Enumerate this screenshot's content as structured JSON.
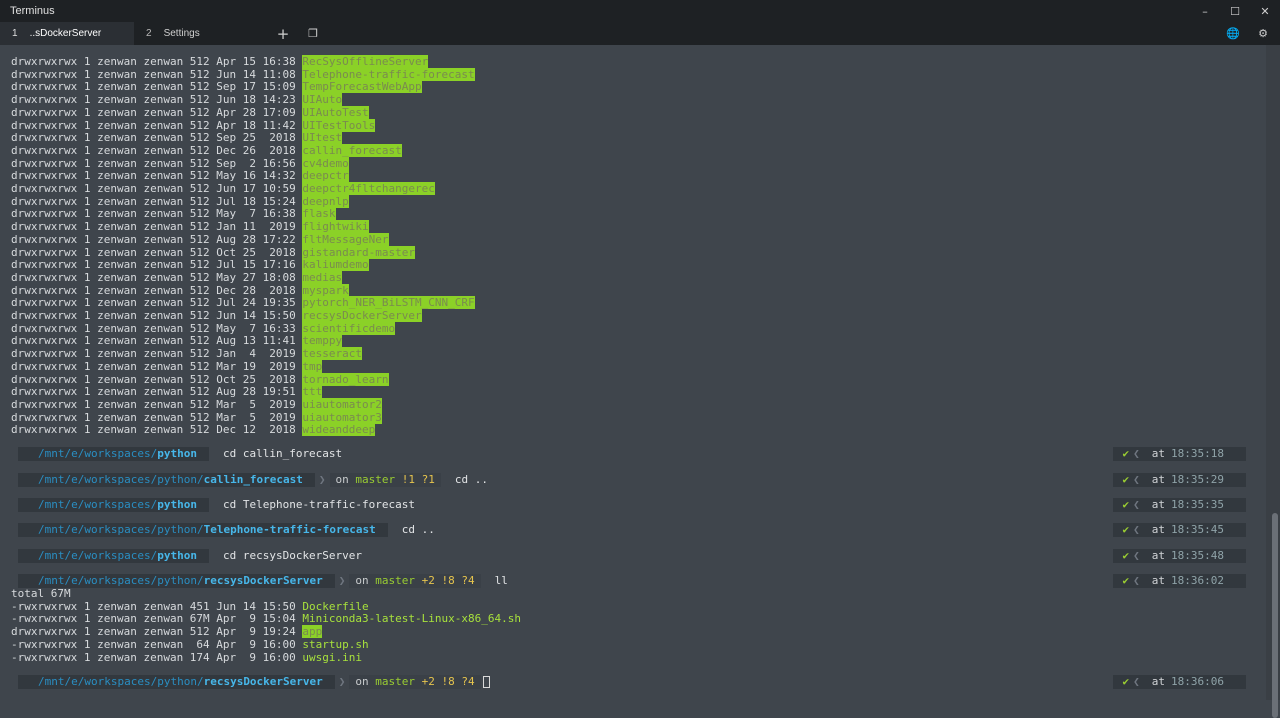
{
  "app": {
    "title": "Terminus",
    "window_controls": [
      "–",
      "☐",
      "✕"
    ]
  },
  "tabs": [
    {
      "num": "1",
      "label": "..sDockerServer",
      "active": true
    },
    {
      "num": "2",
      "label": "Settings",
      "active": false
    }
  ],
  "tabbar_buttons": {
    "add": "+",
    "restore": "❐",
    "globe": "🌐",
    "gear": "⚙"
  },
  "listing": [
    {
      "perm": "drwxrwxrwx",
      "links": "1",
      "user": "zenwan",
      "group": "zenwan",
      "size": "512",
      "date": "Apr 15 16:38",
      "name": "RecSysOfflineServer"
    },
    {
      "perm": "drwxrwxrwx",
      "links": "1",
      "user": "zenwan",
      "group": "zenwan",
      "size": "512",
      "date": "Jun 14 11:08",
      "name": "Telephone-traffic-forecast"
    },
    {
      "perm": "drwxrwxrwx",
      "links": "1",
      "user": "zenwan",
      "group": "zenwan",
      "size": "512",
      "date": "Sep 17 15:09",
      "name": "TempForecastWebApp"
    },
    {
      "perm": "drwxrwxrwx",
      "links": "1",
      "user": "zenwan",
      "group": "zenwan",
      "size": "512",
      "date": "Jun 18 14:23",
      "name": "UIAuto"
    },
    {
      "perm": "drwxrwxrwx",
      "links": "1",
      "user": "zenwan",
      "group": "zenwan",
      "size": "512",
      "date": "Apr 28 17:09",
      "name": "UIAutoTest"
    },
    {
      "perm": "drwxrwxrwx",
      "links": "1",
      "user": "zenwan",
      "group": "zenwan",
      "size": "512",
      "date": "Apr 18 11:42",
      "name": "UITestTools"
    },
    {
      "perm": "drwxrwxrwx",
      "links": "1",
      "user": "zenwan",
      "group": "zenwan",
      "size": "512",
      "date": "Sep 25  2018",
      "name": "UItest"
    },
    {
      "perm": "drwxrwxrwx",
      "links": "1",
      "user": "zenwan",
      "group": "zenwan",
      "size": "512",
      "date": "Dec 26  2018",
      "name": "callin_forecast"
    },
    {
      "perm": "drwxrwxrwx",
      "links": "1",
      "user": "zenwan",
      "group": "zenwan",
      "size": "512",
      "date": "Sep  2 16:56",
      "name": "cv4demo"
    },
    {
      "perm": "drwxrwxrwx",
      "links": "1",
      "user": "zenwan",
      "group": "zenwan",
      "size": "512",
      "date": "May 16 14:32",
      "name": "deepctr"
    },
    {
      "perm": "drwxrwxrwx",
      "links": "1",
      "user": "zenwan",
      "group": "zenwan",
      "size": "512",
      "date": "Jun 17 10:59",
      "name": "deepctr4fltchangerec"
    },
    {
      "perm": "drwxrwxrwx",
      "links": "1",
      "user": "zenwan",
      "group": "zenwan",
      "size": "512",
      "date": "Jul 18 15:24",
      "name": "deepnlp"
    },
    {
      "perm": "drwxrwxrwx",
      "links": "1",
      "user": "zenwan",
      "group": "zenwan",
      "size": "512",
      "date": "May  7 16:38",
      "name": "flask"
    },
    {
      "perm": "drwxrwxrwx",
      "links": "1",
      "user": "zenwan",
      "group": "zenwan",
      "size": "512",
      "date": "Jan 11  2019",
      "name": "flightwiki"
    },
    {
      "perm": "drwxrwxrwx",
      "links": "1",
      "user": "zenwan",
      "group": "zenwan",
      "size": "512",
      "date": "Aug 28 17:22",
      "name": "fltMessageNer"
    },
    {
      "perm": "drwxrwxrwx",
      "links": "1",
      "user": "zenwan",
      "group": "zenwan",
      "size": "512",
      "date": "Oct 25  2018",
      "name": "gistandard-master"
    },
    {
      "perm": "drwxrwxrwx",
      "links": "1",
      "user": "zenwan",
      "group": "zenwan",
      "size": "512",
      "date": "Jul 15 17:16",
      "name": "kaliumdemo"
    },
    {
      "perm": "drwxrwxrwx",
      "links": "1",
      "user": "zenwan",
      "group": "zenwan",
      "size": "512",
      "date": "May 27 18:08",
      "name": "medias"
    },
    {
      "perm": "drwxrwxrwx",
      "links": "1",
      "user": "zenwan",
      "group": "zenwan",
      "size": "512",
      "date": "Dec 28  2018",
      "name": "myspark"
    },
    {
      "perm": "drwxrwxrwx",
      "links": "1",
      "user": "zenwan",
      "group": "zenwan",
      "size": "512",
      "date": "Jul 24 19:35",
      "name": "pytorch_NER_BiLSTM_CNN_CRF"
    },
    {
      "perm": "drwxrwxrwx",
      "links": "1",
      "user": "zenwan",
      "group": "zenwan",
      "size": "512",
      "date": "Jun 14 15:50",
      "name": "recsysDockerServer"
    },
    {
      "perm": "drwxrwxrwx",
      "links": "1",
      "user": "zenwan",
      "group": "zenwan",
      "size": "512",
      "date": "May  7 16:33",
      "name": "scientificdemo"
    },
    {
      "perm": "drwxrwxrwx",
      "links": "1",
      "user": "zenwan",
      "group": "zenwan",
      "size": "512",
      "date": "Aug 13 11:41",
      "name": "temppy"
    },
    {
      "perm": "drwxrwxrwx",
      "links": "1",
      "user": "zenwan",
      "group": "zenwan",
      "size": "512",
      "date": "Jan  4  2019",
      "name": "tesseract"
    },
    {
      "perm": "drwxrwxrwx",
      "links": "1",
      "user": "zenwan",
      "group": "zenwan",
      "size": "512",
      "date": "Mar 19  2019",
      "name": "tmp"
    },
    {
      "perm": "drwxrwxrwx",
      "links": "1",
      "user": "zenwan",
      "group": "zenwan",
      "size": "512",
      "date": "Oct 25  2018",
      "name": "tornado_learn"
    },
    {
      "perm": "drwxrwxrwx",
      "links": "1",
      "user": "zenwan",
      "group": "zenwan",
      "size": "512",
      "date": "Aug 28 19:51",
      "name": "ttt"
    },
    {
      "perm": "drwxrwxrwx",
      "links": "1",
      "user": "zenwan",
      "group": "zenwan",
      "size": "512",
      "date": "Mar  5  2019",
      "name": "uiautomator2"
    },
    {
      "perm": "drwxrwxrwx",
      "links": "1",
      "user": "zenwan",
      "group": "zenwan",
      "size": "512",
      "date": "Mar  5  2019",
      "name": "uiautomator3"
    },
    {
      "perm": "drwxrwxrwx",
      "links": "1",
      "user": "zenwan",
      "group": "zenwan",
      "size": "512",
      "date": "Dec 12  2018",
      "name": "wideanddeep"
    }
  ],
  "prompts": [
    {
      "prefix": "/mnt/e/workspaces/",
      "cwd": "python",
      "git": null,
      "command": "cd callin_forecast",
      "time": "18:35:18"
    },
    {
      "prefix": "/mnt/e/workspaces/python/",
      "cwd": "callin_forecast",
      "git": {
        "on": "on",
        "branch": "master",
        "status": "!1 ?1"
      },
      "command": "cd ..",
      "time": "18:35:29"
    },
    {
      "prefix": "/mnt/e/workspaces/",
      "cwd": "python",
      "git": null,
      "command": "cd Telephone-traffic-forecast",
      "time": "18:35:35"
    },
    {
      "prefix": "/mnt/e/workspaces/python/",
      "cwd": "Telephone-traffic-forecast",
      "git": null,
      "command": "cd ..",
      "time": "18:35:45"
    },
    {
      "prefix": "/mnt/e/workspaces/",
      "cwd": "python",
      "git": null,
      "command": "cd recsysDockerServer",
      "time": "18:35:48"
    },
    {
      "prefix": "/mnt/e/workspaces/python/",
      "cwd": "recsysDockerServer",
      "git": {
        "on": "on",
        "branch": "master",
        "status": "+2 !8 ?4"
      },
      "command": "ll",
      "time": "18:36:02"
    }
  ],
  "ll_output": {
    "total": "total 67M",
    "files": [
      {
        "meta": "-rwxrwxrwx 1 zenwan zenwan 451 Jun 14 15:50",
        "name": "Dockerfile",
        "kind": "exe"
      },
      {
        "meta": "-rwxrwxrwx 1 zenwan zenwan 67M Apr  9 15:04",
        "name": "Miniconda3-latest-Linux-x86_64.sh",
        "kind": "exe"
      },
      {
        "meta": "drwxrwxrwx 1 zenwan zenwan 512 Apr  9 19:24",
        "name": "app",
        "kind": "dir"
      },
      {
        "meta": "-rwxrwxrwx 1 zenwan zenwan  64 Apr  9 16:00",
        "name": "startup.sh",
        "kind": "exe"
      },
      {
        "meta": "-rwxrwxrwx 1 zenwan zenwan 174 Apr  9 16:00",
        "name": "uwsgi.ini",
        "kind": "exe"
      }
    ]
  },
  "final_prompt": {
    "prefix": "/mnt/e/workspaces/python/",
    "cwd": "recsysDockerServer",
    "git": {
      "on": "on",
      "branch": "master",
      "status": "+2 !8 ?4"
    },
    "time": "18:36:06"
  },
  "status_glyphs": {
    "ok": "✔",
    "at": "at"
  },
  "colors": {
    "dir_bg": "#8bd127",
    "path": "#2a8ec2",
    "cwd": "#47b7ea",
    "branch": "#9acd32",
    "git_status": "#e6c44e",
    "ok": "#9acd32"
  }
}
